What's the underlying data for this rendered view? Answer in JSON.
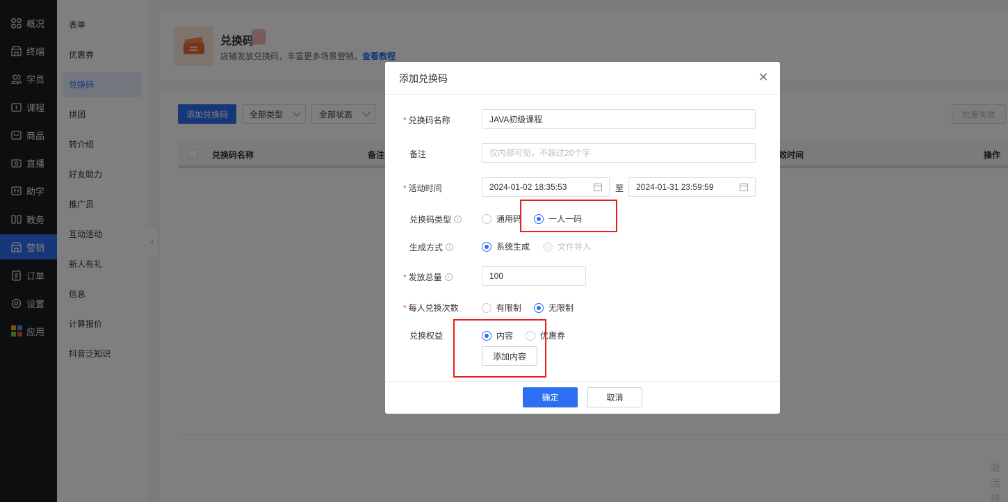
{
  "nav": {
    "items": [
      {
        "label": "概况",
        "icon": "overview-icon"
      },
      {
        "label": "终端",
        "icon": "store-icon"
      },
      {
        "label": "学员",
        "icon": "users-icon"
      },
      {
        "label": "课程",
        "icon": "course-icon"
      },
      {
        "label": "商品",
        "icon": "goods-icon"
      },
      {
        "label": "直播",
        "icon": "live-icon"
      },
      {
        "label": "助学",
        "icon": "assist-icon"
      },
      {
        "label": "教务",
        "icon": "academic-icon"
      },
      {
        "label": "营销",
        "icon": "marketing-icon",
        "active": true
      },
      {
        "label": "订单",
        "icon": "order-icon"
      },
      {
        "label": "设置",
        "icon": "settings-icon"
      },
      {
        "label": "应用",
        "icon": "apps-icon"
      }
    ]
  },
  "subnav": {
    "items": [
      {
        "label": "表单"
      },
      {
        "label": "优惠券"
      },
      {
        "label": "兑换码",
        "active": true
      },
      {
        "label": "拼团"
      },
      {
        "label": "转介绍"
      },
      {
        "label": "好友助力"
      },
      {
        "label": "推广员"
      },
      {
        "label": "互动活动"
      },
      {
        "label": "新人有礼"
      },
      {
        "label": "信息"
      },
      {
        "label": "计算报价"
      },
      {
        "label": "抖音泛知识"
      }
    ]
  },
  "header": {
    "title": "兑换码",
    "desc": "店铺发放兑换码，丰富更多场景营销。",
    "link": "查看教程"
  },
  "toolbar": {
    "add_label": "添加兑换码",
    "type_filter": "全部类型",
    "status_filter": "全部状态",
    "batch_invalid": "批量失效"
  },
  "table": {
    "columns": [
      "兑换码名称",
      "备注",
      "效时间",
      "操作"
    ]
  },
  "watermark": {
    "line1": "激活",
    "line2": "转到"
  },
  "modal": {
    "title": "添加兑换码",
    "name_label": "兑换码名称",
    "name_value": "JAVA初级课程",
    "remark_label": "备注",
    "remark_placeholder": "仅内部可见，不超过20个字",
    "time_label": "活动时间",
    "start_time": "2024-01-02 18:35:53",
    "to_text": "至",
    "end_time": "2024-01-31 23:59:59",
    "type_label": "兑换码类型",
    "type_options": [
      "通用码",
      "一人一码"
    ],
    "gen_label": "生成方式",
    "gen_options": [
      "系统生成",
      "文件导入"
    ],
    "total_label": "发放总量",
    "total_value": "100",
    "limit_label": "每人兑换次数",
    "limit_options": [
      "有限制",
      "无限制"
    ],
    "benefit_label": "兑换权益",
    "benefit_options": [
      "内容",
      "优惠券"
    ],
    "add_content": "添加内容",
    "ok": "确定",
    "cancel": "取消"
  },
  "colors": {
    "primary": "#2d6ff2",
    "nav_bg": "#1b1c20",
    "required": "#f2403f",
    "highlight_box": "#e8201d"
  }
}
